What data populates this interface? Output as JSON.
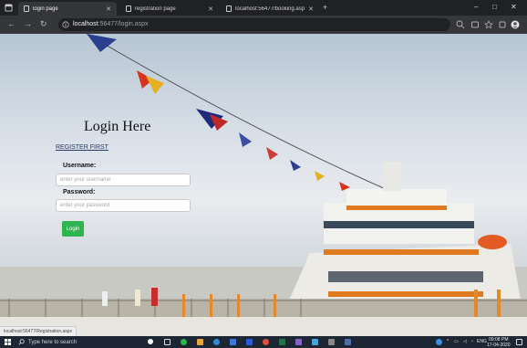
{
  "browser": {
    "tabs": [
      {
        "label": "login page",
        "active": true
      },
      {
        "label": "registration page",
        "active": false
      },
      {
        "label": "localhost:56477/booking.aspx",
        "active": false
      }
    ],
    "url_host": "localhost",
    "url_rest": ":56477/login.aspx"
  },
  "login": {
    "title": "Login Here",
    "register_link": "REGISTER FIRST",
    "username_label": "Username:",
    "username_placeholder": "enter your username",
    "password_label": "Password:",
    "password_placeholder": "enter your password",
    "login_button": "Login"
  },
  "status_bar": {
    "url": "localhost:56477/Registration.aspx"
  },
  "taskbar": {
    "search_placeholder": "Type here to search",
    "language": "ENG",
    "time": "09:08 PM",
    "date": "17-04-2020"
  },
  "colors": {
    "accent_button": "#2fb44f",
    "link": "#2a3c6a",
    "chrome_dark": "#202124",
    "chrome_toolbar": "#35363a",
    "taskbar": "#1d2733"
  }
}
